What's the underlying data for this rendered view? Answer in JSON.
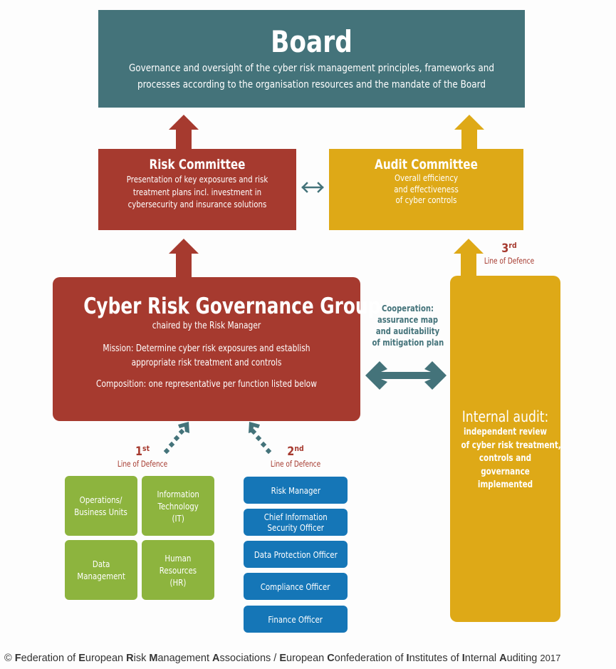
{
  "colors": {
    "board": "#44737a",
    "risk": "#a63a2f",
    "audit": "#dea917",
    "first_line": "#8db43e",
    "second_line": "#1576b7",
    "connector": "#44737a"
  },
  "board": {
    "title": "Board",
    "description_line1": "Governance and oversight of the cyber risk management principles, frameworks and",
    "description_line2": "processes according to the organisation resources and the mandate of the Board"
  },
  "risk_committee": {
    "title": "Risk Committee",
    "description_line1": "Presentation of key exposures and risk",
    "description_line2": "treatment plans incl. investment  in",
    "description_line3": "cybersecurity and insurance solutions"
  },
  "audit_committee": {
    "title": "Audit Committee",
    "description_line1": "Overall efficiency",
    "description_line2": "and effectiveness",
    "description_line3": "of cyber controls"
  },
  "cyber_risk_governance_group": {
    "title": "Cyber Risk Governance Group",
    "subtitle": "chaired by the Risk Manager",
    "mission_line1": "Mission: Determine cyber risk exposures and establish",
    "mission_line2": "appropriate risk treatment and controls",
    "composition": "Composition: one representative per function listed below"
  },
  "cooperation": {
    "line1": "Cooperation:",
    "line2": "assurance map",
    "line3": "and auditability",
    "line4": "of mitigation plan"
  },
  "internal_audit": {
    "title": "Internal audit:",
    "line1": "independent review",
    "line2": "of cyber risk treatment,",
    "line3": "controls and",
    "line4": "governance",
    "line5": "implemented"
  },
  "lines_of_defence": {
    "first": {
      "number": "1",
      "suffix": "st",
      "label": "Line of Defence"
    },
    "second": {
      "number": "2",
      "suffix": "nd",
      "label": "Line of Defence"
    },
    "third": {
      "number": "3",
      "suffix": "rd",
      "label": "Line of Defence"
    }
  },
  "first_line_functions": [
    {
      "label": "Operations/\nBusiness Units"
    },
    {
      "label": "Information\nTechnology\n(IT)"
    },
    {
      "label": "Data\nManagement"
    },
    {
      "label": "Human\nResources\n(HR)"
    }
  ],
  "second_line_functions": [
    {
      "label": "Risk Manager"
    },
    {
      "label": "Chief Information\nSecurity Officer"
    },
    {
      "label": "Data Protection Officer"
    },
    {
      "label": "Compliance Officer"
    },
    {
      "label": "Finance Officer"
    }
  ],
  "footer": {
    "copyright": "©",
    "org1": [
      "F",
      "ederation of ",
      "E",
      "uropean ",
      "R",
      "isk ",
      "M",
      "anagement ",
      "A",
      "ssociations"
    ],
    "separator": " / ",
    "org2": [
      "E",
      "uropean ",
      "C",
      "onfederation of ",
      "I",
      "nstitutes of ",
      "I",
      "nternal ",
      "A",
      "uditing"
    ],
    "year": "2017"
  }
}
